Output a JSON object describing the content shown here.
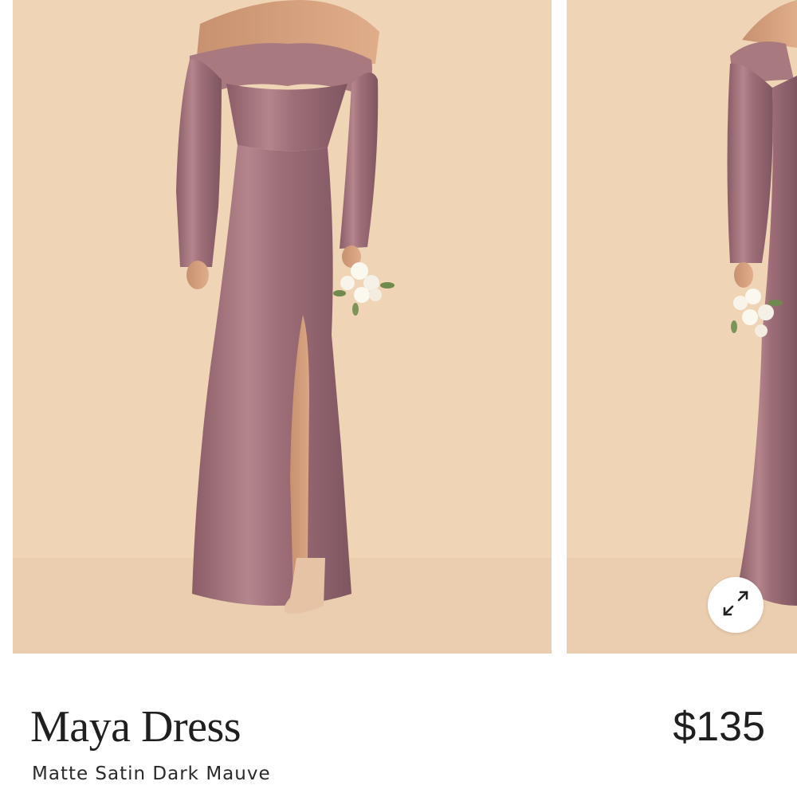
{
  "product": {
    "name": "Maya Dress",
    "variant": "Matte Satin Dark Mauve",
    "price": "$135"
  },
  "gallery": {
    "expand_icon": "expand-arrows-icon",
    "images": [
      {
        "name": "front-view",
        "visible": "full"
      },
      {
        "name": "side-view",
        "visible": "partial"
      }
    ]
  },
  "colors": {
    "backdrop": "#efd4b6",
    "dress": "#a0707a",
    "text": "#1f1f1f"
  }
}
